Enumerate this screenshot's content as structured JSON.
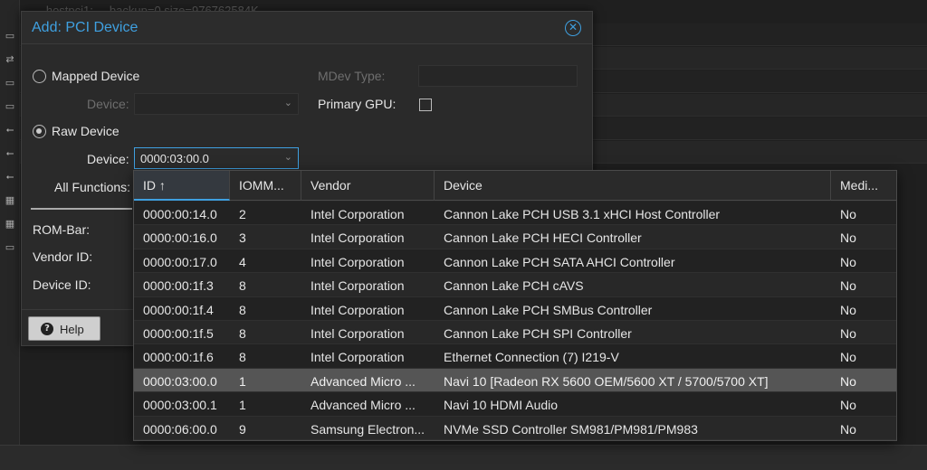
{
  "background": {
    "top_line": "...hostpci1: ... backup=0,size=976762584K",
    "sidebar_icons": [
      "disk-icon",
      "network-icon",
      "disk-icon",
      "disk-icon",
      "usb-icon",
      "usb-icon",
      "usb-icon",
      "pci-icon",
      "pci-icon",
      "disk-icon"
    ]
  },
  "dialog": {
    "title": "Add: PCI Device",
    "mapped_device_label": "Mapped Device",
    "mapped_device_field_label": "Device:",
    "mdev_type_label": "MDev Type:",
    "primary_gpu_label": "Primary GPU:",
    "raw_device_label": "Raw Device",
    "raw_device_field_label": "Device:",
    "raw_device_value": "0000:03:00.0",
    "all_functions_label": "All Functions:",
    "rom_bar_label": "ROM-Bar:",
    "vendor_id_label": "Vendor ID:",
    "device_id_label": "Device ID:",
    "help_label": "Help",
    "help_icon": "?"
  },
  "grid": {
    "columns": [
      {
        "label": "ID ↑"
      },
      {
        "label": "IOMM..."
      },
      {
        "label": "Vendor"
      },
      {
        "label": "Device"
      },
      {
        "label": "Medi..."
      }
    ],
    "rows": [
      {
        "id": "0000:00:14.0",
        "iommu": "2",
        "vendor": "Intel Corporation",
        "device": "Cannon Lake PCH USB 3.1 xHCI Host Controller",
        "mdev": "No"
      },
      {
        "id": "0000:00:16.0",
        "iommu": "3",
        "vendor": "Intel Corporation",
        "device": "Cannon Lake PCH HECI Controller",
        "mdev": "No"
      },
      {
        "id": "0000:00:17.0",
        "iommu": "4",
        "vendor": "Intel Corporation",
        "device": "Cannon Lake PCH SATA AHCI Controller",
        "mdev": "No"
      },
      {
        "id": "0000:00:1f.3",
        "iommu": "8",
        "vendor": "Intel Corporation",
        "device": "Cannon Lake PCH cAVS",
        "mdev": "No"
      },
      {
        "id": "0000:00:1f.4",
        "iommu": "8",
        "vendor": "Intel Corporation",
        "device": "Cannon Lake PCH SMBus Controller",
        "mdev": "No"
      },
      {
        "id": "0000:00:1f.5",
        "iommu": "8",
        "vendor": "Intel Corporation",
        "device": "Cannon Lake PCH SPI Controller",
        "mdev": "No"
      },
      {
        "id": "0000:00:1f.6",
        "iommu": "8",
        "vendor": "Intel Corporation",
        "device": "Ethernet Connection (7) I219-V",
        "mdev": "No"
      },
      {
        "id": "0000:03:00.0",
        "iommu": "1",
        "vendor": "Advanced Micro ...",
        "device": "Navi 10 [Radeon RX 5600 OEM/5600 XT / 5700/5700 XT]",
        "mdev": "No"
      },
      {
        "id": "0000:03:00.1",
        "iommu": "1",
        "vendor": "Advanced Micro ...",
        "device": "Navi 10 HDMI Audio",
        "mdev": "No"
      },
      {
        "id": "0000:06:00.0",
        "iommu": "9",
        "vendor": "Samsung Electron...",
        "device": "NVMe SSD Controller SM981/PM981/PM983",
        "mdev": "No"
      }
    ],
    "selected_row": 7
  },
  "colors": {
    "accent": "#3fa0e0",
    "selected_row": "#555555"
  }
}
